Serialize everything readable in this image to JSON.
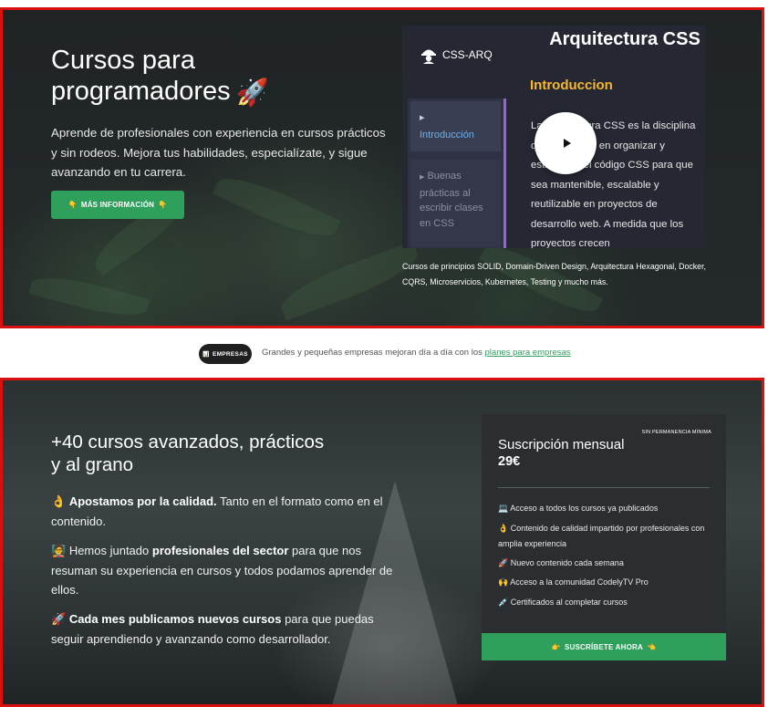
{
  "hero": {
    "title": "Cursos para programadores",
    "rocket_icon": "🚀",
    "description": "Aprende de profesionales con experiencia en cursos prácticos y sin rodeos. Mejora tus habilidades, especialízate, y sigue avanzando en tu carrera.",
    "button_emoji": "👇",
    "button_label": "MÁS INFORMACIÓN",
    "video": {
      "brand": "CSS-ARQ",
      "course_title": "Arquitectura CSS",
      "intro_heading": "Introduccion",
      "nav_active": "Introducción",
      "nav_second": "Buenas prácticas al escribir clases en CSS",
      "nav_marker": "▶",
      "body_text": "La Arquitectura CSS es la disciplina que se enfoca en organizar y estructurar el código CSS para que sea mantenible, escalable y reutilizable en proyectos de desarrollo web. A medida que los proyectos crecen",
      "play_icon": "play-icon"
    },
    "caption": "Cursos de principios SOLID, Domain-Driven Design, Arquitectura Hexagonal, Docker, CQRS, Microservicios, Kubernetes, Testing y mucho más."
  },
  "band": {
    "pill_icon": "📊",
    "pill_label": "EMPRESAS",
    "text": "Grandes y pequeñas empresas mejoran día a día con los",
    "link": "planes para empresas"
  },
  "pricing": {
    "title": "+40 cursos avanzados, prácticos y al grano",
    "features": [
      {
        "emoji": "👌",
        "bold": "Apostamos por la calidad.",
        "text": " Tanto en el formato como en el contenido."
      },
      {
        "emoji": "🧑‍🏫",
        "pre": "Hemos juntado ",
        "bold": "profesionales del sector",
        "text": " para que nos resuman su experiencia en cursos y todos podamos aprender de ellos."
      },
      {
        "emoji": "🚀",
        "bold": "Cada mes publicamos nuevos cursos",
        "text": " para que puedas seguir aprendiendo y avanzando como desarrollador."
      }
    ],
    "card": {
      "badge": "SIN PERMANENCIA MÍNIMA",
      "title": "Suscripción mensual",
      "price": "29€",
      "benefits": [
        {
          "emoji": "💻",
          "text": "Acceso a todos los cursos ya publicados"
        },
        {
          "emoji": "👌",
          "text": "Contenido de calidad impartido por profesionales con amplia experiencia"
        },
        {
          "emoji": "🚀",
          "text": "Nuevo contenido cada semana"
        },
        {
          "emoji": "🙌",
          "text": "Acceso a la comunidad CodelyTV Pro"
        },
        {
          "emoji": "💉",
          "text": "Certificados al completar cursos"
        }
      ],
      "cta_emoji_left": "👉",
      "cta_label": "SUSCRÍBETE AHORA",
      "cta_emoji_right": "👈"
    }
  },
  "colors": {
    "accent_green": "#2ea05c",
    "frame_red": "#d81010",
    "intro_yellow": "#f5b82e",
    "nav_blue": "#6cb2ea"
  }
}
